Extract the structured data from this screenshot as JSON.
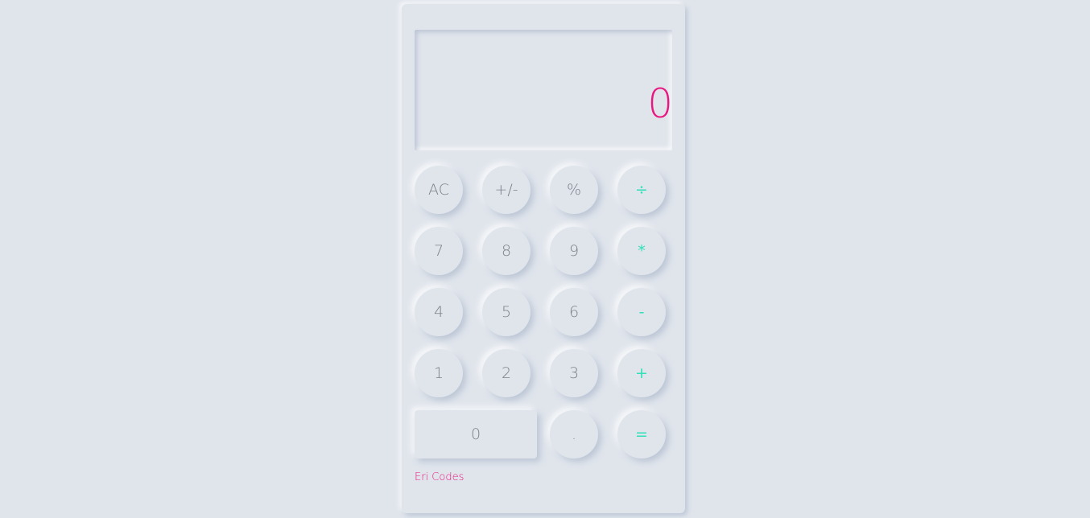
{
  "display": {
    "value": "0"
  },
  "keys": {
    "ac": "AC",
    "sign": "+/-",
    "percent": "%",
    "divide": "÷",
    "seven": "7",
    "eight": "8",
    "nine": "9",
    "multiply": "*",
    "four": "4",
    "five": "5",
    "six": "6",
    "subtract": "-",
    "one": "1",
    "two": "2",
    "three": "3",
    "add": "+",
    "zero": "0",
    "decimal": ".",
    "equals": "="
  },
  "footer": {
    "credit": "Eri Codes"
  },
  "colors": {
    "background": "#e0e5ec",
    "display_text": "#e9177f",
    "operator_text": "#2fe0b8",
    "digit_text": "#7d8189"
  }
}
